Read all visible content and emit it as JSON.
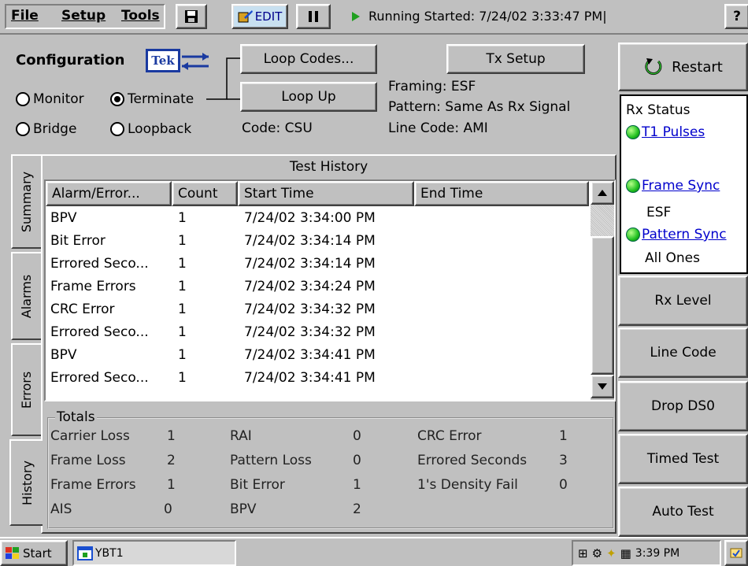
{
  "menubar": {
    "file": "File",
    "setup": "Setup",
    "tools": "Tools",
    "edit_label": "EDIT",
    "status": "Running Started: 7/24/02 3:33:47 PM|",
    "help": "?"
  },
  "config": {
    "title": "Configuration",
    "logo": "Tek",
    "modes": [
      "Monitor",
      "Terminate",
      "Bridge",
      "Loopback"
    ],
    "selected_mode": "Terminate",
    "loop_codes_btn": "Loop Codes...",
    "loop_up_btn": "Loop Up",
    "code": "Code: CSU",
    "tx_setup_btn": "Tx Setup",
    "framing": "Framing: ESF",
    "pattern": "Pattern: Same As Rx Signal",
    "line_code": "Line Code:  AMI"
  },
  "right_panel": {
    "restart": "Restart",
    "rx_status_title": "Rx Status",
    "t1_pulses": "T1 Pulses",
    "frame_sync": "Frame Sync",
    "frame_sync_value": "ESF",
    "pattern_sync": "Pattern Sync",
    "pattern_sync_value": "All Ones",
    "buttons": [
      "Rx Level",
      "Line Code",
      "Drop DS0",
      "Timed Test",
      "Auto Test"
    ]
  },
  "tabs": [
    "Summary",
    "Alarms",
    "Errors",
    "History"
  ],
  "active_tab": "History",
  "history": {
    "title": "Test History",
    "columns": [
      "Alarm/Error...",
      "Count",
      "Start Time",
      "End Time"
    ],
    "rows": [
      {
        "name": "BPV",
        "count": "1",
        "start": "7/24/02 3:34:00 PM",
        "end": ""
      },
      {
        "name": "Bit Error",
        "count": "1",
        "start": "7/24/02 3:34:14 PM",
        "end": ""
      },
      {
        "name": "Errored Seco...",
        "count": "1",
        "start": "7/24/02 3:34:14 PM",
        "end": ""
      },
      {
        "name": "Frame Errors",
        "count": "1",
        "start": "7/24/02 3:34:24 PM",
        "end": ""
      },
      {
        "name": "CRC Error",
        "count": "1",
        "start": "7/24/02 3:34:32 PM",
        "end": ""
      },
      {
        "name": "Errored Seco...",
        "count": "1",
        "start": "7/24/02 3:34:32 PM",
        "end": ""
      },
      {
        "name": "BPV",
        "count": "1",
        "start": "7/24/02 3:34:41 PM",
        "end": ""
      },
      {
        "name": "Errored Seco...",
        "count": "1",
        "start": "7/24/02 3:34:41 PM",
        "end": ""
      }
    ]
  },
  "totals": {
    "title": "Totals",
    "col1": [
      {
        "label": "Carrier Loss",
        "value": "1"
      },
      {
        "label": "Frame Loss",
        "value": "2"
      },
      {
        "label": "Frame Errors",
        "value": "1"
      },
      {
        "label": "AIS",
        "value": "0"
      }
    ],
    "col2": [
      {
        "label": "RAI",
        "value": "0"
      },
      {
        "label": "Pattern Loss",
        "value": "0"
      },
      {
        "label": "Bit Error",
        "value": "1"
      },
      {
        "label": "BPV",
        "value": "2"
      }
    ],
    "col3": [
      {
        "label": "CRC Error",
        "value": "1"
      },
      {
        "label": "Errored Seconds",
        "value": "3"
      },
      {
        "label": "1's Density Fail",
        "value": "0"
      }
    ]
  },
  "taskbar": {
    "start": "Start",
    "app": "YBT1",
    "clock": "3:39 PM"
  }
}
